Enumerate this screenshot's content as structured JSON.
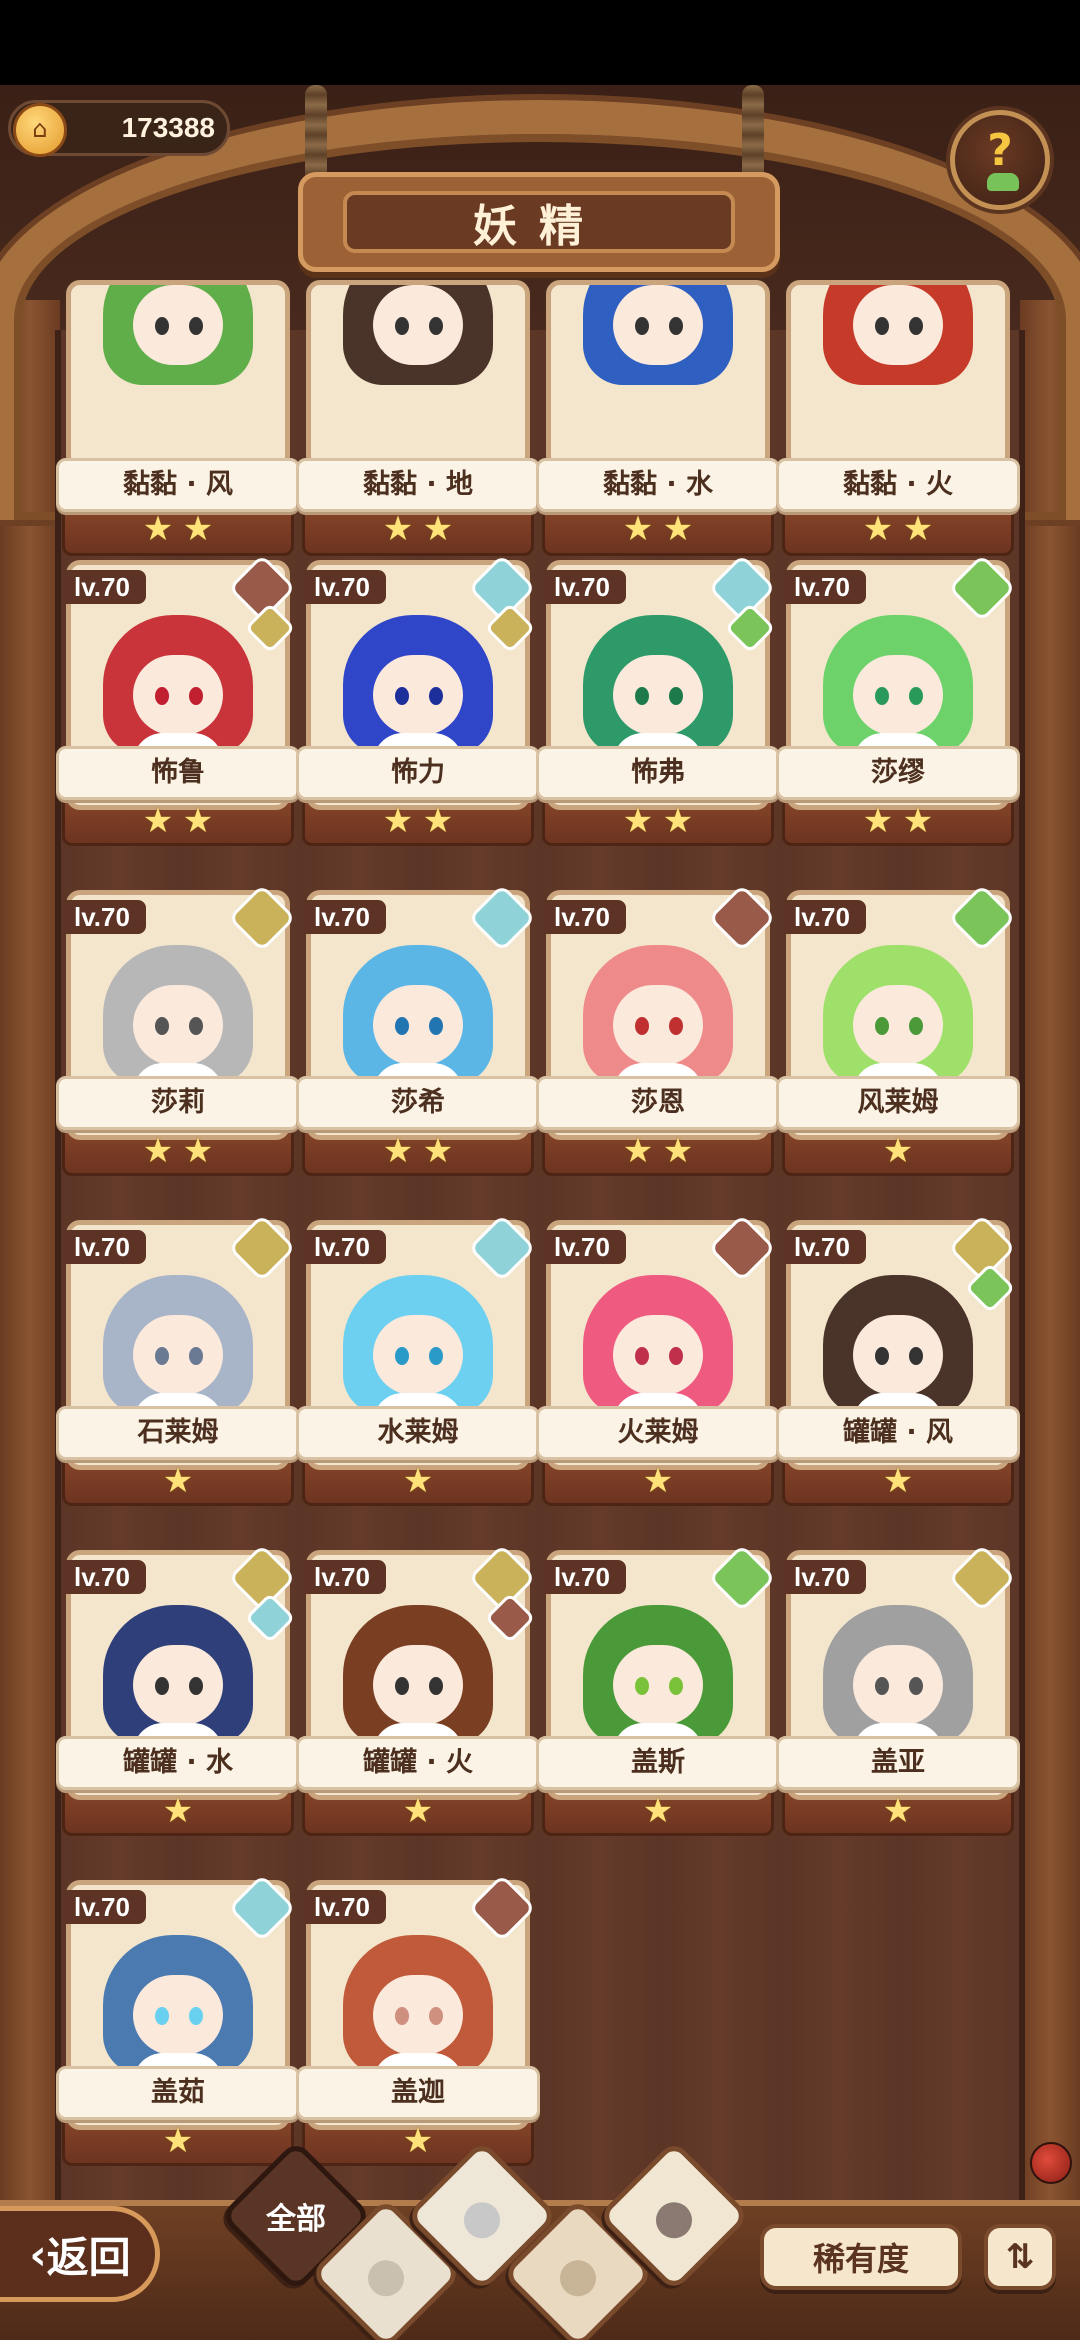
{
  "header": {
    "title": "妖精",
    "coins": "173388",
    "help_symbol": "?"
  },
  "colors": {
    "accent": "#d79a5a",
    "card_bg": "#f4e6cc",
    "star": "#ffe27a"
  },
  "top_row": [
    {
      "name": "黏黏 · 风",
      "stars": 2,
      "hair": "#5fae4a",
      "eye": "#333"
    },
    {
      "name": "黏黏 · 地",
      "stars": 2,
      "hair": "#4a3328",
      "eye": "#333"
    },
    {
      "name": "黏黏 · 水",
      "stars": 2,
      "hair": "#2f5fc0",
      "eye": "#333"
    },
    {
      "name": "黏黏 · 火",
      "stars": 2,
      "hair": "#c63a2a",
      "eye": "#333"
    }
  ],
  "cards": [
    {
      "level": "lv.70",
      "name": "怖鲁",
      "stars": 2,
      "element": "fire",
      "element2": "earth",
      "hair": "#c8343a",
      "eye": "#c02030"
    },
    {
      "level": "lv.70",
      "name": "怖力",
      "stars": 2,
      "element": "water",
      "element2": "earth",
      "hair": "#2f46c8",
      "eye": "#1c2f9a"
    },
    {
      "level": "lv.70",
      "name": "怖弗",
      "stars": 2,
      "element": "water",
      "element2": "wood",
      "hair": "#2e9a6a",
      "eye": "#1d7a4a"
    },
    {
      "level": "lv.70",
      "name": "莎缪",
      "stars": 2,
      "element": "wood",
      "element2": "",
      "hair": "#6dd26a",
      "eye": "#2a9a5a"
    },
    {
      "level": "lv.70",
      "name": "莎莉",
      "stars": 2,
      "element": "earth",
      "element2": "",
      "hair": "#b7b7b7",
      "eye": "#555"
    },
    {
      "level": "lv.70",
      "name": "莎希",
      "stars": 2,
      "element": "water",
      "element2": "",
      "hair": "#5bb6e6",
      "eye": "#2176b2"
    },
    {
      "level": "lv.70",
      "name": "莎恩",
      "stars": 2,
      "element": "fire",
      "element2": "",
      "hair": "#ef8a8a",
      "eye": "#c03030"
    },
    {
      "level": "lv.70",
      "name": "风莱姆",
      "stars": 1,
      "element": "wood",
      "element2": "",
      "hair": "#9ee06a",
      "eye": "#4a9a3a"
    },
    {
      "level": "lv.70",
      "name": "石莱姆",
      "stars": 1,
      "element": "earth",
      "element2": "",
      "hair": "#a8b4c8",
      "eye": "#6a7a92"
    },
    {
      "level": "lv.70",
      "name": "水莱姆",
      "stars": 1,
      "element": "water",
      "element2": "",
      "hair": "#6ed0f0",
      "eye": "#2a9ac8"
    },
    {
      "level": "lv.70",
      "name": "火莱姆",
      "stars": 1,
      "element": "fire",
      "element2": "",
      "hair": "#ef5a80",
      "eye": "#c0304a"
    },
    {
      "level": "lv.70",
      "name": "罐罐 · 风",
      "stars": 1,
      "element": "earth",
      "element2": "wood",
      "hair": "#4a3328",
      "eye": "#333"
    },
    {
      "level": "lv.70",
      "name": "罐罐 · 水",
      "stars": 1,
      "element": "earth",
      "element2": "water",
      "hair": "#2e3f7a",
      "eye": "#333"
    },
    {
      "level": "lv.70",
      "name": "罐罐 · 火",
      "stars": 1,
      "element": "earth",
      "element2": "fire",
      "hair": "#7a3e22",
      "eye": "#333"
    },
    {
      "level": "lv.70",
      "name": "盖斯",
      "stars": 1,
      "element": "wood",
      "element2": "",
      "hair": "#4a9a3a",
      "eye": "#7ac23a"
    },
    {
      "level": "lv.70",
      "name": "盖亚",
      "stars": 1,
      "element": "earth",
      "element2": "",
      "hair": "#a0a0a0",
      "eye": "#555"
    },
    {
      "level": "lv.70",
      "name": "盖茹",
      "stars": 1,
      "element": "water",
      "element2": "",
      "hair": "#4a7ab0",
      "eye": "#6ad0f0"
    },
    {
      "level": "lv.70",
      "name": "盖迦",
      "stars": 1,
      "element": "fire",
      "element2": "",
      "hair": "#c05a3a",
      "eye": "#d09080"
    }
  ],
  "bottom": {
    "back_label": "返回",
    "filter_all_label": "全部",
    "filters": [
      "全部",
      "wood",
      "water",
      "earth",
      "fire"
    ],
    "sort_label": "稀有度",
    "order_icon": "sort-order-icon"
  }
}
